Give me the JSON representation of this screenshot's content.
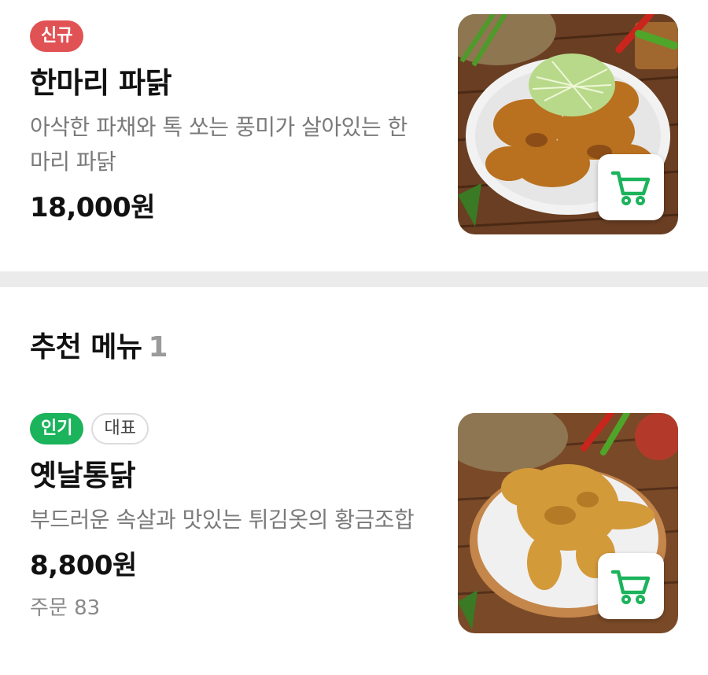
{
  "items": [
    {
      "badges": [
        {
          "label": "신규",
          "style": "new"
        }
      ],
      "name": "한마리 파닭",
      "description": "아삭한 파채와 톡 쏘는 풍미가 살아있는 한마리 파닭",
      "price": "18,000원",
      "cart_icon": "cart-icon"
    },
    {
      "badges": [
        {
          "label": "인기",
          "style": "popular"
        },
        {
          "label": "대표",
          "style": "outline"
        }
      ],
      "name": "옛날통닭",
      "description": "부드러운 속살과 맛있는 튀김옷의 황금조합",
      "price": "8,800원",
      "orders_label": "주문",
      "orders_count": "83",
      "cart_icon": "cart-icon"
    }
  ],
  "section": {
    "title": "추천 메뉴",
    "count": "1"
  },
  "colors": {
    "new_badge": "#e15254",
    "popular_badge": "#1bb35b",
    "cart_icon": "#1bb35b",
    "divider": "#ebebeb"
  }
}
